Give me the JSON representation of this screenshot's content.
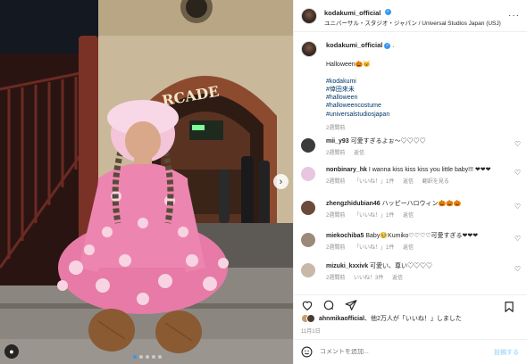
{
  "post": {
    "username": "kodakumi_official",
    "location": "ユニバーサル・スタジオ・ジャパン / Universal Studios Japan (USJ)",
    "more_icon": "more-horizontal-icon",
    "verified_icon": "verified-badge-icon",
    "photo_sign_text": "RCADE",
    "carousel": {
      "slide_count": 5,
      "active_index": 0
    }
  },
  "caption": {
    "username": "kodakumi_official",
    "separator": ".",
    "text": "Halloween🎃🐱",
    "hashtags": [
      "#kodakumi",
      "#倖田來未",
      "#halloween",
      "#halloweencostume",
      "#universalstudiosjapan"
    ],
    "time": "2週間前"
  },
  "comments": [
    {
      "user": "mii_y93",
      "text": "可愛すぎるよぉ〜♡♡♡♡",
      "time": "2週間前",
      "likes": "",
      "reply": "返信",
      "translate": "",
      "avatar_color": "#3b3b3b"
    },
    {
      "user": "nonbinary_hk",
      "text": "I wanna kiss kiss kiss you little baby!!! ❤❤❤",
      "time": "2週間前",
      "likes": "「いいね！」1件",
      "reply": "返信",
      "translate": "翻訳を見る",
      "avatar_color": "#e8c6e0"
    },
    {
      "user": "zhengzhidubian46",
      "text": "ハッピーハロウィン🎃🎃🎃",
      "time": "2週間前",
      "likes": "「いいね！」1件",
      "reply": "返信",
      "translate": "",
      "avatar_color": "#6b4a3a"
    },
    {
      "user": "miekochiba5",
      "text": "Baby🥹Kumiko♡♡♡♡可愛すぎる❤❤❤",
      "time": "2週間前",
      "likes": "「いいね！」1件",
      "reply": "返信",
      "translate": "",
      "avatar_color": "#9a8a7a"
    },
    {
      "user": "mizuki_kxxivk",
      "text": "可愛い、尊い♡♡♡♡",
      "time": "2週間前",
      "likes": "いいね！3件",
      "reply": "返信",
      "translate": "",
      "avatar_color": "#c9b8a8"
    }
  ],
  "likes_line": {
    "user": "ahnmikaofficial",
    "rest": "、他2万人が「いいね！」しました"
  },
  "date": "11月1日",
  "composer": {
    "placeholder": "コメントを追加...",
    "post_label": "投稿する"
  },
  "icons": {
    "like": "heart-icon",
    "comment": "comment-icon",
    "share": "share-icon",
    "save": "bookmark-icon",
    "emoji": "emoji-icon",
    "next": "chevron-right-icon",
    "tag": "user-tag-icon"
  }
}
